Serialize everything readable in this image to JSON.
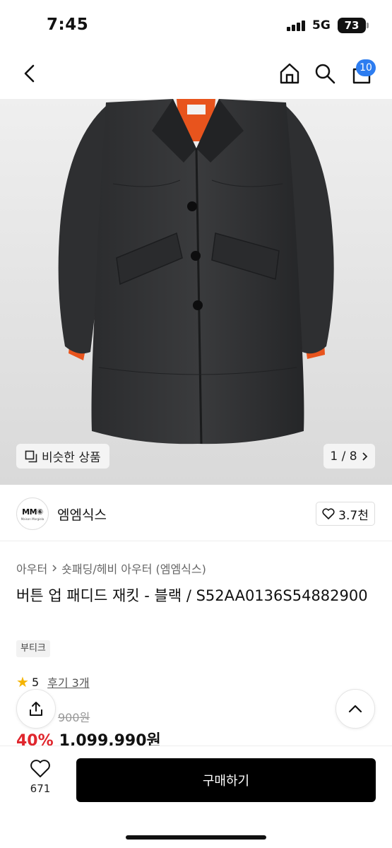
{
  "status": {
    "time": "7:45",
    "network": "5G",
    "battery": "73"
  },
  "nav": {
    "cart_count": "10"
  },
  "gallery": {
    "similar_label": "비슷한 상품",
    "pager": "1 / 8"
  },
  "brand": {
    "logo_text": "MM⑥",
    "logo_subtext": "Maison Margiela",
    "name": "엠엠식스",
    "likes": "3.7천"
  },
  "product": {
    "breadcrumb": [
      "아우터",
      "숏패딩/헤비 아우터 (엠엠식스)"
    ],
    "title": "버튼 업 패디드 재킷 - 블랙 / S52AA0136S54882900",
    "tag": "부티크",
    "rating": "5",
    "reviews": "후기 3개",
    "original_price": "900원",
    "discount": "40%",
    "price": "1,099,990원"
  },
  "bottom": {
    "wish_count": "671",
    "buy_label": "구매하기"
  },
  "colors": {
    "accent": "#e0262d",
    "badge": "#2d7df0",
    "lining": "#e8541d"
  }
}
